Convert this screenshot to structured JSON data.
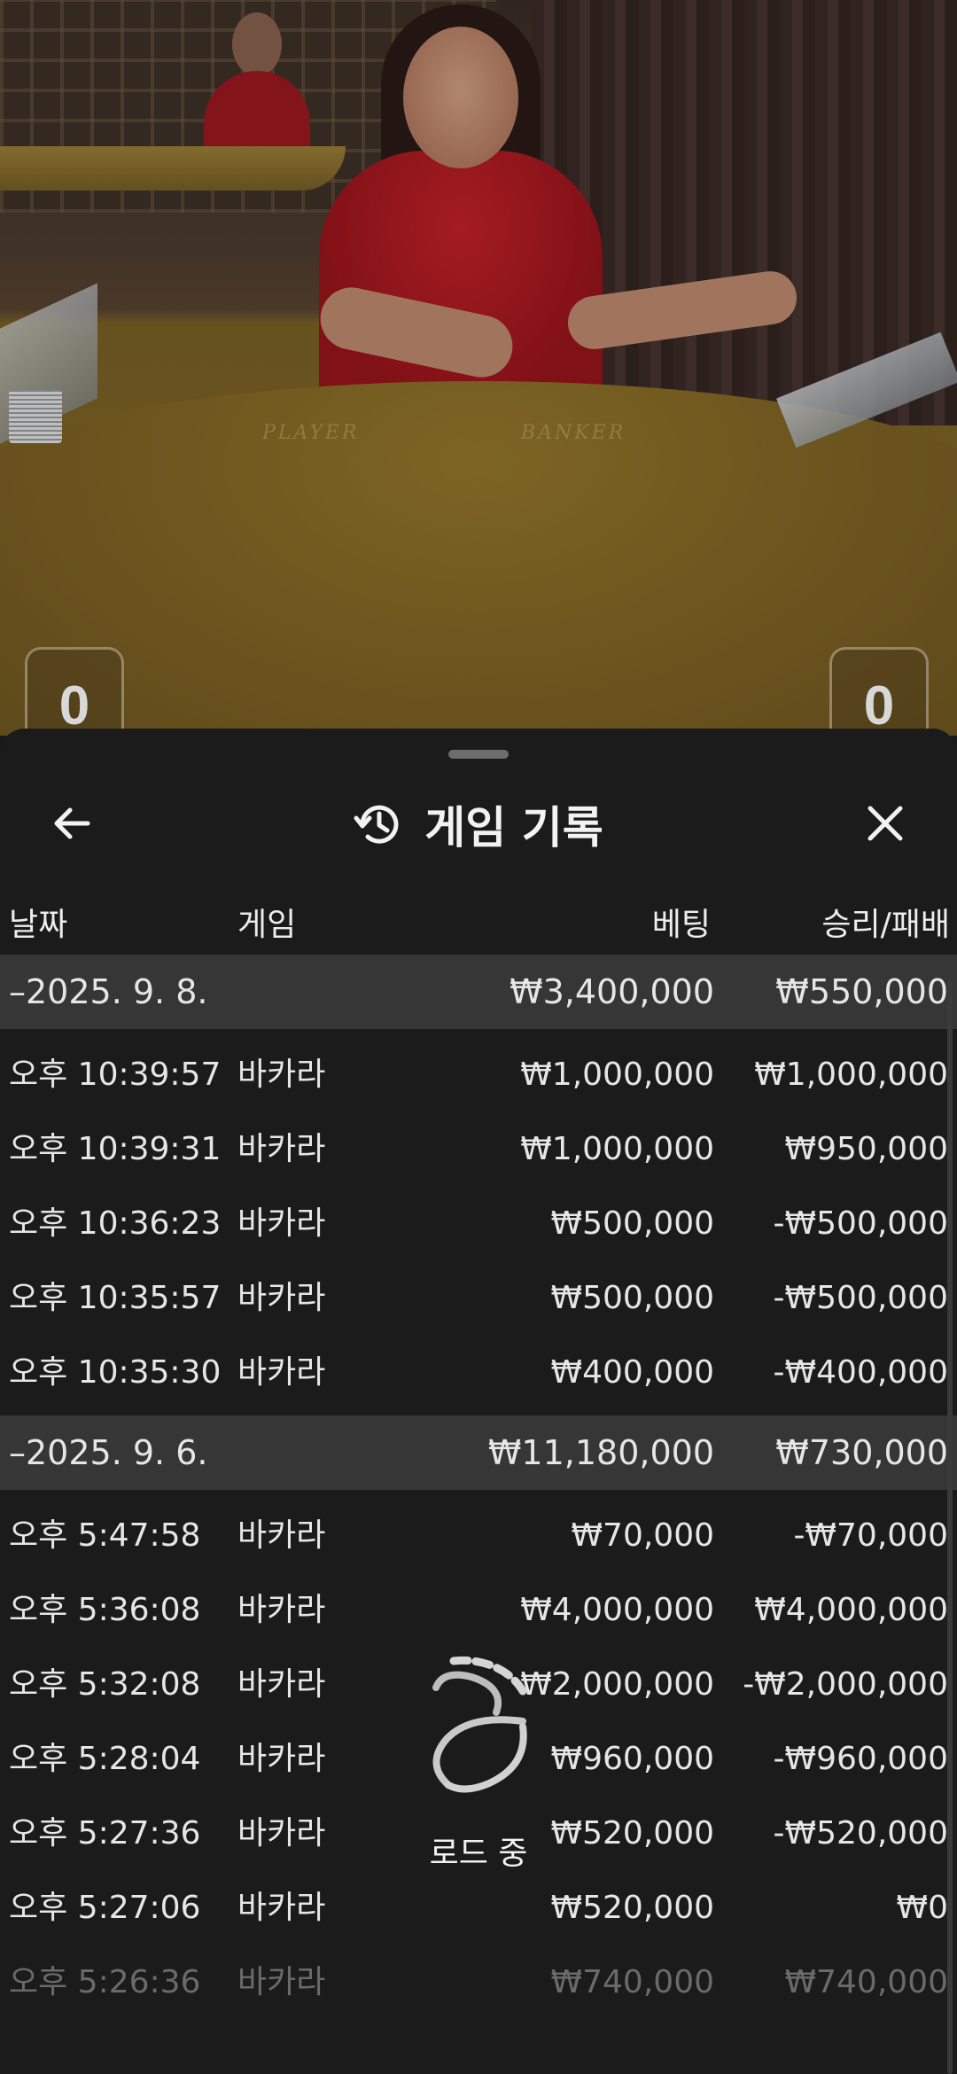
{
  "video": {
    "table_labels": [
      "PLAYER",
      "BANKER"
    ],
    "score_left": "0",
    "score_right": "0"
  },
  "sheet": {
    "title": "게임 기록",
    "icons": {
      "back": "arrow-left-icon",
      "history": "history-clock-icon",
      "close": "close-icon",
      "loading": "loading-spinner-icon"
    },
    "columns": {
      "date": "날짜",
      "game": "게임",
      "bet": "베팅",
      "result": "승리/패배"
    },
    "groups": [
      {
        "date": "–2025. 9. 8.",
        "bet_total": "₩3,400,000",
        "result_total": "₩550,000",
        "rows": [
          {
            "time": "오후 10:39:57",
            "game": "바카라",
            "bet": "₩1,000,000",
            "result": "₩1,000,000"
          },
          {
            "time": "오후 10:39:31",
            "game": "바카라",
            "bet": "₩1,000,000",
            "result": "₩950,000"
          },
          {
            "time": "오후 10:36:23",
            "game": "바카라",
            "bet": "₩500,000",
            "result": "-₩500,000"
          },
          {
            "time": "오후 10:35:57",
            "game": "바카라",
            "bet": "₩500,000",
            "result": "-₩500,000"
          },
          {
            "time": "오후 10:35:30",
            "game": "바카라",
            "bet": "₩400,000",
            "result": "-₩400,000"
          }
        ]
      },
      {
        "date": "–2025. 9. 6.",
        "bet_total": "₩11,180,000",
        "result_total": "₩730,000",
        "rows": [
          {
            "time": "오후 5:47:58",
            "game": "바카라",
            "bet": "₩70,000",
            "result": "-₩70,000"
          },
          {
            "time": "오후 5:36:08",
            "game": "바카라",
            "bet": "₩4,000,000",
            "result": "₩4,000,000"
          },
          {
            "time": "오후 5:32:08",
            "game": "바카라",
            "bet": "₩2,000,000",
            "result": "-₩2,000,000"
          },
          {
            "time": "오후 5:28:04",
            "game": "바카라",
            "bet": "₩960,000",
            "result": "-₩960,000"
          },
          {
            "time": "오후 5:27:36",
            "game": "바카라",
            "bet": "₩520,000",
            "result": "-₩520,000"
          },
          {
            "time": "오후 5:27:06",
            "game": "바카라",
            "bet": "₩520,000",
            "result": "₩0"
          },
          {
            "time": "오후 5:26:36",
            "game": "바카라",
            "bet": "₩740,000",
            "result": "₩740,000"
          }
        ]
      }
    ],
    "loading_text": "로드 중"
  }
}
